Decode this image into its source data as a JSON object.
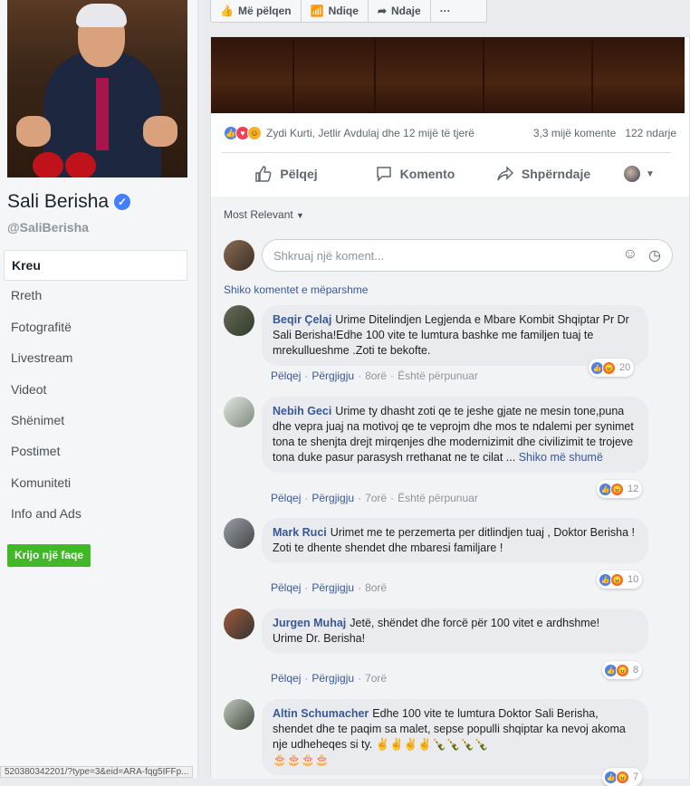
{
  "sidebar": {
    "page_name": "Sali Berisha",
    "handle": "@SaliBerisha",
    "nav": [
      {
        "label": "Kreu"
      },
      {
        "label": "Rreth"
      },
      {
        "label": "Fotografitë"
      },
      {
        "label": "Livestream"
      },
      {
        "label": "Videot"
      },
      {
        "label": "Shënimet"
      },
      {
        "label": "Postimet"
      },
      {
        "label": "Komuniteti"
      },
      {
        "label": "Info and Ads"
      }
    ],
    "create_page": "Krijo një faqe"
  },
  "topbar": {
    "like": "Më pëlqen",
    "follow": "Ndiqe",
    "share": "Ndaje",
    "more": "···"
  },
  "post": {
    "reactions_text": "Zydi Kurti, Jetlir Avdulaj dhe 12 mijë të tjerë",
    "comments_count": "3,3 mijë komente",
    "shares_count": "122 ndarje",
    "actions": {
      "like": "Pëlqej",
      "comment": "Komento",
      "share": "Shpërndaje"
    }
  },
  "comments_section": {
    "sort": "Most Relevant",
    "input_placeholder": "Shkruaj një koment...",
    "previous_link": "Shiko komentet e mëparshme",
    "meta_like": "Pëlqej",
    "meta_reply": "Përgjigju",
    "meta_edited": "Është përpunuar",
    "see_more": "Shiko më shumë",
    "comments": [
      {
        "author": "Beqir Çelaj",
        "text": "Urime Ditelindjen Legjenda e Mbare Kombit Shqiptar Pr Dr Sali Berisha!Edhe 100 vite te lumtura bashke me familjen tuaj te mrekullueshme .Zoti te bekofte.",
        "time": "8orë",
        "edited": true,
        "reactions": "20"
      },
      {
        "author": "Nebih Geci",
        "text": "Urime ty dhasht zoti qe te jeshe gjate ne mesin tone,puna dhe vepra juaj na motivoj qe te veprojm dhe mos te ndalemi per synimet tona te shenjta drejt mirqenjes dhe modernizimit dhe civilizimit te trojeve tona duke pasur parasysh rrethanat ne te cilat ...",
        "time": "7orë",
        "edited": true,
        "reactions": "12"
      },
      {
        "author": "Mark Ruci",
        "text": "Urimet me te perzemerta per ditlindjen tuaj , Doktor Berisha !",
        "text2": "Zoti te dhente shendet dhe mbaresi familjare !",
        "time": "8orë",
        "edited": false,
        "reactions": "10"
      },
      {
        "author": "Jurgen Muhaj",
        "text": "Jetë, shëndet dhe forcë për 100 vitet e ardhshme!",
        "text2": "Urime Dr. Berisha!",
        "time": "7orë",
        "edited": false,
        "reactions": "8"
      },
      {
        "author": "Altin Schumacher",
        "text": "Edhe 100 vite te lumtura Doktor Sali Berisha, shendet dhe te paqim sa malet, sepse populli shqiptar ka nevoj akoma nje udheheqes si ty. ✌✌✌✌🍾🍾🍾🍾",
        "text2": "🎂🎂🎂🎂",
        "reactions": "7"
      }
    ]
  },
  "status_url": "520380342201/?type=3&eid=ARA-fqg5IFFp..."
}
